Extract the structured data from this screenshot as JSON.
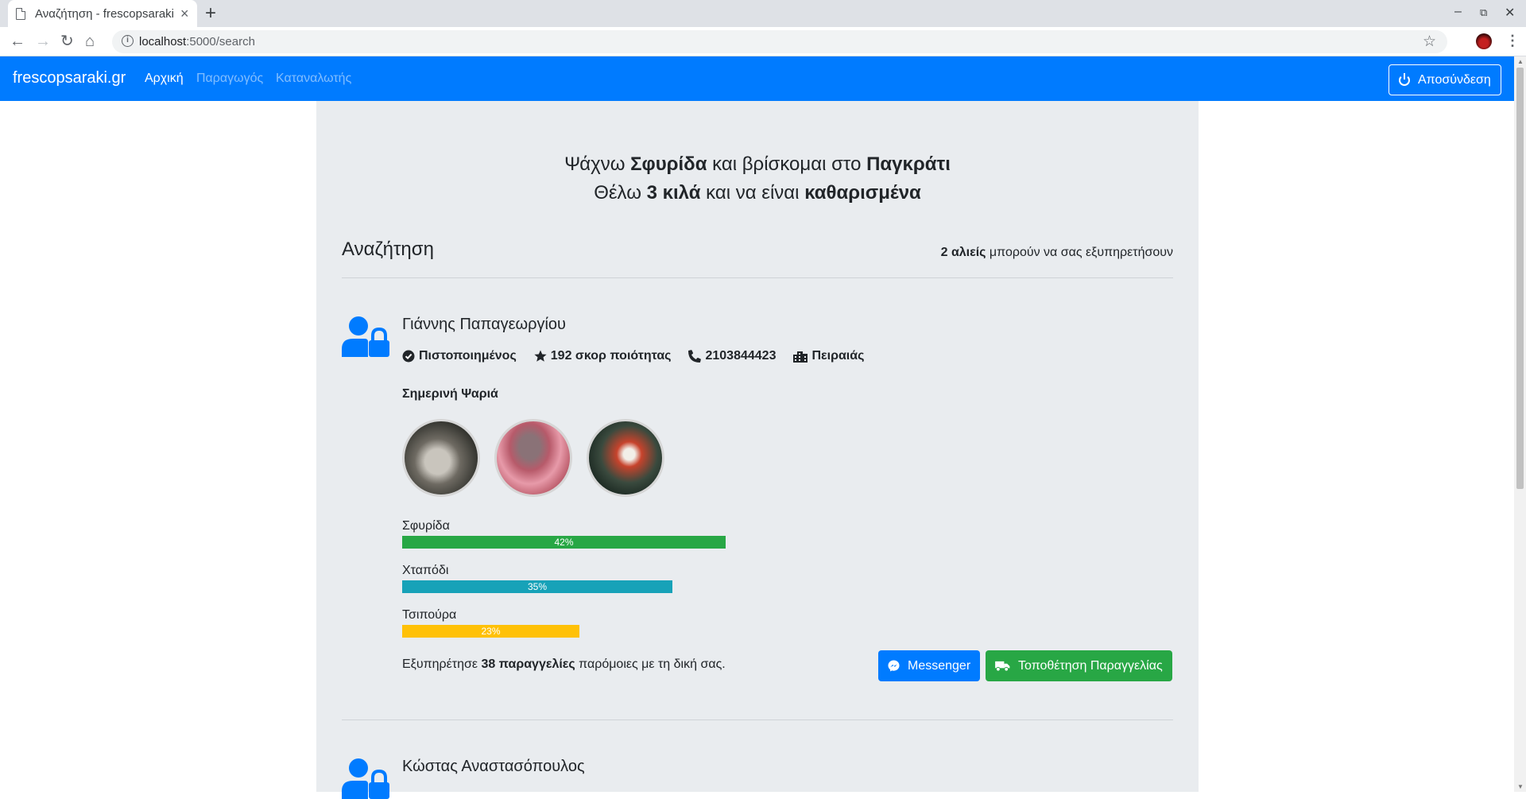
{
  "browser": {
    "tab_title": "Αναζήτηση - frescopsaraki.gr",
    "url_host": "localhost",
    "url_path": ":5000/search"
  },
  "nav": {
    "brand": "frescopsaraki.gr",
    "links": [
      "Αρχική",
      "Παραγωγός",
      "Καταναλωτής"
    ],
    "logout": "Αποσύνδεση"
  },
  "hero": {
    "line1": [
      "Ψάχνω ",
      "Σφυρίδα",
      " και βρίσκομαι στο ",
      "Παγκράτι"
    ],
    "line2": [
      "Θέλω ",
      "3 κιλά",
      " και να είναι ",
      "καθαρισμένα"
    ]
  },
  "search": {
    "title": "Αναζήτηση",
    "count_bold": "2 αλιείς",
    "count_rest": " μπορούν να σας εξυπηρετήσουν"
  },
  "fishermen": [
    {
      "name": "Γιάννης Παπαγεωργίου",
      "verified": "Πιστοποιημένος",
      "score": "192 σκορ ποιότητας",
      "phone": "2103844423",
      "city": "Πειραιάς",
      "today_label": "Σημερινή Ψαριά",
      "catch": [
        {
          "label": "Σφυρίδα",
          "percent": 42,
          "text": "42%",
          "color": "#28a745"
        },
        {
          "label": "Χταπόδι",
          "percent": 35,
          "text": "35%",
          "color": "#17a2b8"
        },
        {
          "label": "Τσιπούρα",
          "percent": 23,
          "text": "23%",
          "color": "#ffc107"
        }
      ],
      "served_pre": "Εξυπηρέτησε ",
      "served_bold": "38 παραγγελίες",
      "served_post": " παρόμοιες με τη δική σας.",
      "messenger": "Messenger",
      "order": "Τοποθέτηση Παραγγελίας"
    },
    {
      "name": "Κώστας Αναστασόπουλος"
    }
  ],
  "colors": {
    "primary": "#007bff",
    "success": "#28a745",
    "info": "#17a2b8",
    "warning": "#ffc107",
    "panel": "#e9ecef"
  }
}
